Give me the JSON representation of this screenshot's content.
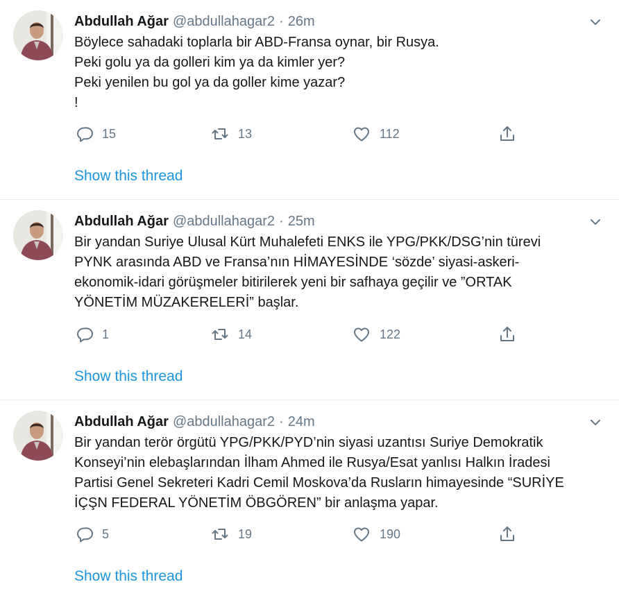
{
  "tweets": [
    {
      "name": "Abdullah Ağar",
      "handle": "@abdullahagar2",
      "separator": "·",
      "time": "26m",
      "lines": [
        "Böylece sahadaki toplarla bir ABD-Fransa oynar, bir Rusya.",
        "Peki golu ya da golleri kim ya da kimler yer?",
        "Peki yenilen bu gol ya da goller kime yazar?",
        "!"
      ],
      "replies": "15",
      "retweets": "13",
      "likes": "112",
      "thread_link": "Show this thread"
    },
    {
      "name": "Abdullah Ağar",
      "handle": "@abdullahagar2",
      "separator": "·",
      "time": "25m",
      "lines": [
        "Bir yandan Suriye Ulusal Kürt Muhalefeti ENKS ile YPG/PKK/DSG’nin türevi",
        "PYNK arasında ABD ve Fransa’nın HİMAYESİNDE ‘sözde’ siyasi-askeri-",
        "ekonomik-idari görüşmeler bitirilerek yeni bir safhaya geçilir ve ”ORTAK",
        "YÖNETİM MÜZAKERELERİ” başlar."
      ],
      "replies": "1",
      "retweets": "14",
      "likes": "122",
      "thread_link": "Show this thread"
    },
    {
      "name": "Abdullah Ağar",
      "handle": "@abdullahagar2",
      "separator": "·",
      "time": "24m",
      "lines": [
        "Bir yandan terör örgütü YPG/PKK/PYD’nin siyasi uzantısı Suriye Demokratik",
        "Konseyi’nin elebaşlarından İlham Ahmed ile Rusya/Esat yanlısı Halkın İradesi",
        "Partisi Genel Sekreteri Kadri Cemil Moskova’da Rusların himayesinde “SURİYE",
        "İÇŞN FEDERAL YÖNETİM ÖBGÖREN” bir anlaşma yapar."
      ],
      "replies": "5",
      "retweets": "19",
      "likes": "190",
      "thread_link": "Show this thread"
    }
  ],
  "colors": {
    "text": "#14171a",
    "muted": "#657786",
    "link": "#1b95e0",
    "divider": "#e6ecf0"
  },
  "icons": {
    "reply": "reply-icon",
    "retweet": "retweet-icon",
    "like": "heart-icon",
    "share": "share-icon",
    "more": "chevron-down-icon"
  }
}
